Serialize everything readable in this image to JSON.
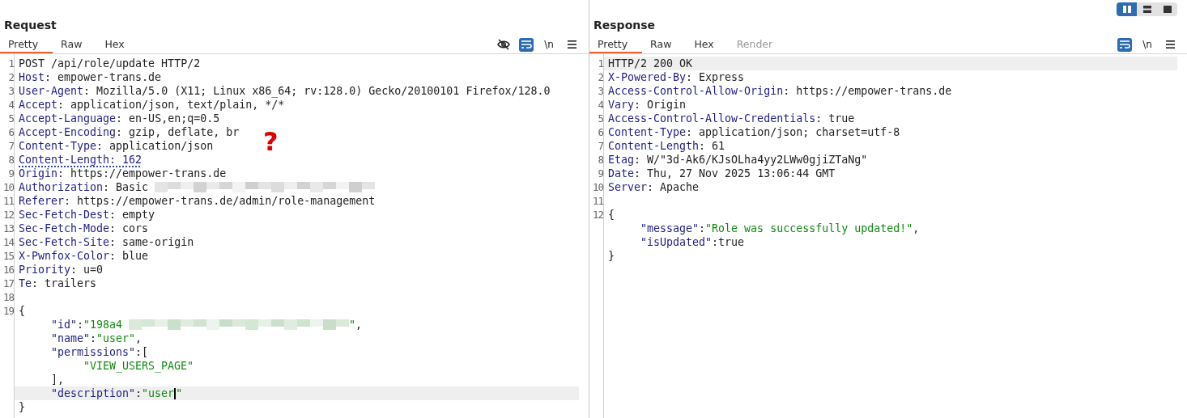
{
  "layout_buttons": [
    {
      "kind": "columns",
      "selected": true
    },
    {
      "kind": "rows",
      "selected": false
    },
    {
      "kind": "single",
      "selected": false
    }
  ],
  "request": {
    "title": "Request",
    "tabs": [
      {
        "label": "Pretty",
        "selected": true,
        "disabled": false
      },
      {
        "label": "Raw",
        "selected": false,
        "disabled": false
      },
      {
        "label": "Hex",
        "selected": false,
        "disabled": false
      }
    ],
    "toolbar": [
      {
        "kind": "eye-off",
        "on": false
      },
      {
        "kind": "wrap",
        "on": true
      },
      {
        "kind": "newline",
        "label": "\\n",
        "on": false
      },
      {
        "kind": "menu",
        "on": false
      }
    ],
    "annotation": "?",
    "lines": [
      {
        "number": "1",
        "highlighted": false,
        "tokens": [
          {
            "kind": "plain",
            "text": "POST /api/role/update HTTP/2"
          }
        ]
      },
      {
        "number": "2",
        "highlighted": false,
        "tokens": [
          {
            "kind": "key",
            "text": "Host"
          },
          {
            "kind": "plain",
            "text": ": empower-trans.de"
          }
        ]
      },
      {
        "number": "3",
        "highlighted": false,
        "tokens": [
          {
            "kind": "key",
            "text": "User-Agent"
          },
          {
            "kind": "plain",
            "text": ": Mozilla/5.0 (X11; Linux x86_64; rv:128.0) Gecko/20100101 Firefox/128.0"
          }
        ]
      },
      {
        "number": "4",
        "highlighted": false,
        "tokens": [
          {
            "kind": "key",
            "text": "Accept"
          },
          {
            "kind": "plain",
            "text": ": application/json, text/plain, */*"
          }
        ]
      },
      {
        "number": "5",
        "highlighted": false,
        "tokens": [
          {
            "kind": "key",
            "text": "Accept-Language"
          },
          {
            "kind": "plain",
            "text": ": en-US,en;q=0.5"
          }
        ]
      },
      {
        "number": "6",
        "highlighted": false,
        "tokens": [
          {
            "kind": "key",
            "text": "Accept-Encoding"
          },
          {
            "kind": "plain",
            "text": ": gzip, deflate, br"
          }
        ]
      },
      {
        "number": "7",
        "highlighted": false,
        "tokens": [
          {
            "kind": "key",
            "text": "Content-Type"
          },
          {
            "kind": "plain",
            "text": ": application/json"
          }
        ]
      },
      {
        "number": "8",
        "highlighted": false,
        "tokens": [
          {
            "kind": "underlined",
            "text": "Content-Length: 162"
          }
        ]
      },
      {
        "number": "9",
        "highlighted": false,
        "tokens": [
          {
            "kind": "key",
            "text": "Origin"
          },
          {
            "kind": "plain",
            "text": ": https://empower-trans.de"
          }
        ]
      },
      {
        "number": "10",
        "highlighted": false,
        "tokens": [
          {
            "kind": "key",
            "text": "Authorization"
          },
          {
            "kind": "plain",
            "text": ": Basic"
          },
          {
            "kind": "redacted"
          }
        ]
      },
      {
        "number": "11",
        "highlighted": false,
        "tokens": [
          {
            "kind": "key",
            "text": "Referer"
          },
          {
            "kind": "plain",
            "text": ": https://empower-trans.de/admin/role-management"
          }
        ]
      },
      {
        "number": "12",
        "highlighted": false,
        "tokens": [
          {
            "kind": "key",
            "text": "Sec-Fetch-Dest"
          },
          {
            "kind": "plain",
            "text": ": empty"
          }
        ]
      },
      {
        "number": "13",
        "highlighted": false,
        "tokens": [
          {
            "kind": "key",
            "text": "Sec-Fetch-Mode"
          },
          {
            "kind": "plain",
            "text": ": cors"
          }
        ]
      },
      {
        "number": "14",
        "highlighted": false,
        "tokens": [
          {
            "kind": "key",
            "text": "Sec-Fetch-Site"
          },
          {
            "kind": "plain",
            "text": ": same-origin"
          }
        ]
      },
      {
        "number": "15",
        "highlighted": false,
        "tokens": [
          {
            "kind": "key",
            "text": "X-Pwnfox-Color"
          },
          {
            "kind": "plain",
            "text": ": blue"
          }
        ]
      },
      {
        "number": "16",
        "highlighted": false,
        "tokens": [
          {
            "kind": "key",
            "text": "Priority"
          },
          {
            "kind": "plain",
            "text": ": u=0"
          }
        ]
      },
      {
        "number": "17",
        "highlighted": false,
        "tokens": [
          {
            "kind": "key",
            "text": "Te"
          },
          {
            "kind": "plain",
            "text": ": trailers"
          }
        ]
      },
      {
        "number": "18",
        "highlighted": false
      },
      {
        "number": "19",
        "highlighted": false,
        "tokens": [
          {
            "kind": "plain",
            "text": "{"
          }
        ],
        "children": [
          {
            "highlighted": false,
            "tokens": [
              {
                "kind": "key",
                "text": "\"id\""
              },
              {
                "kind": "plain",
                "text": ":"
              },
              {
                "kind": "string",
                "text": "\"198a4"
              },
              {
                "kind": "redacted"
              },
              {
                "kind": "string",
                "text": "\""
              },
              {
                "kind": "plain",
                "text": ","
              }
            ]
          },
          {
            "highlighted": false,
            "tokens": [
              {
                "kind": "key",
                "text": "\"name\""
              },
              {
                "kind": "plain",
                "text": ":"
              },
              {
                "kind": "string",
                "text": "\"user\""
              },
              {
                "kind": "plain",
                "text": ","
              }
            ]
          },
          {
            "highlighted": false,
            "tokens": [
              {
                "kind": "key",
                "text": "\"permissions\""
              },
              {
                "kind": "plain",
                "text": ":["
              }
            ],
            "children": [
              {
                "highlighted": false,
                "tokens": [
                  {
                    "kind": "string",
                    "text": "\"VIEW_USERS_PAGE\""
                  }
                ]
              }
            ]
          },
          {
            "highlighted": false,
            "tokens": [
              {
                "kind": "plain",
                "text": "],"
              }
            ]
          },
          {
            "highlighted": true,
            "tokens": [
              {
                "kind": "key",
                "text": "\"description\""
              },
              {
                "kind": "plain",
                "text": ":"
              },
              {
                "kind": "string",
                "text": "\"user"
              },
              {
                "kind": "cursor"
              },
              {
                "kind": "string",
                "text": "\""
              }
            ]
          }
        ]
      },
      {
        "highlighted": false,
        "tokens": [
          {
            "kind": "plain",
            "text": "}"
          }
        ]
      }
    ]
  },
  "response": {
    "title": "Response",
    "tabs": [
      {
        "label": "Pretty",
        "selected": true,
        "disabled": false
      },
      {
        "label": "Raw",
        "selected": false,
        "disabled": false
      },
      {
        "label": "Hex",
        "selected": false,
        "disabled": false
      },
      {
        "label": "Render",
        "selected": false,
        "disabled": true
      }
    ],
    "toolbar": [
      {
        "kind": "wrap",
        "on": true
      },
      {
        "kind": "newline",
        "label": "\\n",
        "on": false
      },
      {
        "kind": "menu",
        "on": false
      }
    ],
    "lines": [
      {
        "number": "1",
        "highlighted": true,
        "tokens": [
          {
            "kind": "plain",
            "text": "HTTP/2 200 OK"
          }
        ]
      },
      {
        "number": "2",
        "highlighted": false,
        "tokens": [
          {
            "kind": "key",
            "text": "X-Powered-By"
          },
          {
            "kind": "plain",
            "text": ": Express"
          }
        ]
      },
      {
        "number": "3",
        "highlighted": false,
        "tokens": [
          {
            "kind": "key",
            "text": "Access-Control-Allow-Origin"
          },
          {
            "kind": "plain",
            "text": ": https://empower-trans.de"
          }
        ]
      },
      {
        "number": "4",
        "highlighted": false,
        "tokens": [
          {
            "kind": "key",
            "text": "Vary"
          },
          {
            "kind": "plain",
            "text": ": Origin"
          }
        ]
      },
      {
        "number": "5",
        "highlighted": false,
        "tokens": [
          {
            "kind": "key",
            "text": "Access-Control-Allow-Credentials"
          },
          {
            "kind": "plain",
            "text": ": true"
          }
        ]
      },
      {
        "number": "6",
        "highlighted": false,
        "tokens": [
          {
            "kind": "key",
            "text": "Content-Type"
          },
          {
            "kind": "plain",
            "text": ": application/json; charset=utf-8"
          }
        ]
      },
      {
        "number": "7",
        "highlighted": false,
        "tokens": [
          {
            "kind": "key",
            "text": "Content-Length"
          },
          {
            "kind": "plain",
            "text": ": 61"
          }
        ]
      },
      {
        "number": "8",
        "highlighted": false,
        "tokens": [
          {
            "kind": "key",
            "text": "Etag"
          },
          {
            "kind": "plain",
            "text": ": W/\"3d-Ak6/KJsOLha4yy2LWw0gjiZTaNg\""
          }
        ]
      },
      {
        "number": "9",
        "highlighted": false,
        "tokens": [
          {
            "kind": "key",
            "text": "Date"
          },
          {
            "kind": "plain",
            "text": ": Thu, 27 Nov 2025 13:06:44 GMT"
          }
        ]
      },
      {
        "number": "10",
        "highlighted": false,
        "tokens": [
          {
            "kind": "key",
            "text": "Server"
          },
          {
            "kind": "plain",
            "text": ": Apache"
          }
        ]
      },
      {
        "number": "11",
        "highlighted": false
      },
      {
        "number": "12",
        "highlighted": false,
        "tokens": [
          {
            "kind": "plain",
            "text": "{"
          }
        ],
        "children": [
          {
            "highlighted": false,
            "tokens": [
              {
                "kind": "key",
                "text": "\"message\""
              },
              {
                "kind": "plain",
                "text": ":"
              },
              {
                "kind": "string",
                "text": "\"Role was successfully updated!\""
              },
              {
                "kind": "plain",
                "text": ","
              }
            ]
          },
          {
            "highlighted": false,
            "tokens": [
              {
                "kind": "key",
                "text": "\"isUpdated\""
              },
              {
                "kind": "plain",
                "text": ":true"
              }
            ]
          }
        ]
      },
      {
        "highlighted": false,
        "tokens": [
          {
            "kind": "plain",
            "text": "}"
          }
        ]
      }
    ]
  }
}
